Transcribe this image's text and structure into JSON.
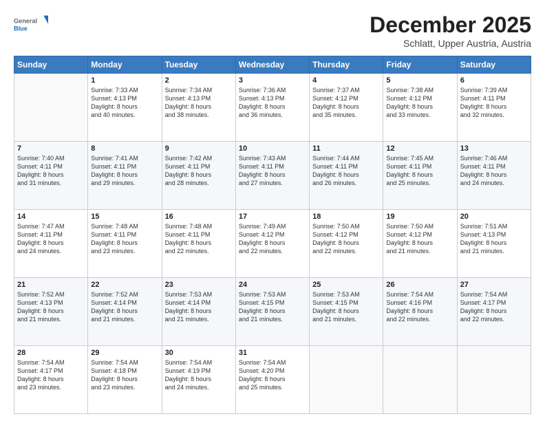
{
  "header": {
    "logo_general": "General",
    "logo_blue": "Blue",
    "month_title": "December 2025",
    "location": "Schlatt, Upper Austria, Austria"
  },
  "weekdays": [
    "Sunday",
    "Monday",
    "Tuesday",
    "Wednesday",
    "Thursday",
    "Friday",
    "Saturday"
  ],
  "weeks": [
    [
      {
        "day": "",
        "text": ""
      },
      {
        "day": "1",
        "text": "Sunrise: 7:33 AM\nSunset: 4:13 PM\nDaylight: 8 hours\nand 40 minutes."
      },
      {
        "day": "2",
        "text": "Sunrise: 7:34 AM\nSunset: 4:13 PM\nDaylight: 8 hours\nand 38 minutes."
      },
      {
        "day": "3",
        "text": "Sunrise: 7:36 AM\nSunset: 4:13 PM\nDaylight: 8 hours\nand 36 minutes."
      },
      {
        "day": "4",
        "text": "Sunrise: 7:37 AM\nSunset: 4:12 PM\nDaylight: 8 hours\nand 35 minutes."
      },
      {
        "day": "5",
        "text": "Sunrise: 7:38 AM\nSunset: 4:12 PM\nDaylight: 8 hours\nand 33 minutes."
      },
      {
        "day": "6",
        "text": "Sunrise: 7:39 AM\nSunset: 4:11 PM\nDaylight: 8 hours\nand 32 minutes."
      }
    ],
    [
      {
        "day": "7",
        "text": "Sunrise: 7:40 AM\nSunset: 4:11 PM\nDaylight: 8 hours\nand 31 minutes."
      },
      {
        "day": "8",
        "text": "Sunrise: 7:41 AM\nSunset: 4:11 PM\nDaylight: 8 hours\nand 29 minutes."
      },
      {
        "day": "9",
        "text": "Sunrise: 7:42 AM\nSunset: 4:11 PM\nDaylight: 8 hours\nand 28 minutes."
      },
      {
        "day": "10",
        "text": "Sunrise: 7:43 AM\nSunset: 4:11 PM\nDaylight: 8 hours\nand 27 minutes."
      },
      {
        "day": "11",
        "text": "Sunrise: 7:44 AM\nSunset: 4:11 PM\nDaylight: 8 hours\nand 26 minutes."
      },
      {
        "day": "12",
        "text": "Sunrise: 7:45 AM\nSunset: 4:11 PM\nDaylight: 8 hours\nand 25 minutes."
      },
      {
        "day": "13",
        "text": "Sunrise: 7:46 AM\nSunset: 4:11 PM\nDaylight: 8 hours\nand 24 minutes."
      }
    ],
    [
      {
        "day": "14",
        "text": "Sunrise: 7:47 AM\nSunset: 4:11 PM\nDaylight: 8 hours\nand 24 minutes."
      },
      {
        "day": "15",
        "text": "Sunrise: 7:48 AM\nSunset: 4:11 PM\nDaylight: 8 hours\nand 23 minutes."
      },
      {
        "day": "16",
        "text": "Sunrise: 7:48 AM\nSunset: 4:11 PM\nDaylight: 8 hours\nand 22 minutes."
      },
      {
        "day": "17",
        "text": "Sunrise: 7:49 AM\nSunset: 4:12 PM\nDaylight: 8 hours\nand 22 minutes."
      },
      {
        "day": "18",
        "text": "Sunrise: 7:50 AM\nSunset: 4:12 PM\nDaylight: 8 hours\nand 22 minutes."
      },
      {
        "day": "19",
        "text": "Sunrise: 7:50 AM\nSunset: 4:12 PM\nDaylight: 8 hours\nand 21 minutes."
      },
      {
        "day": "20",
        "text": "Sunrise: 7:51 AM\nSunset: 4:13 PM\nDaylight: 8 hours\nand 21 minutes."
      }
    ],
    [
      {
        "day": "21",
        "text": "Sunrise: 7:52 AM\nSunset: 4:13 PM\nDaylight: 8 hours\nand 21 minutes."
      },
      {
        "day": "22",
        "text": "Sunrise: 7:52 AM\nSunset: 4:14 PM\nDaylight: 8 hours\nand 21 minutes."
      },
      {
        "day": "23",
        "text": "Sunrise: 7:53 AM\nSunset: 4:14 PM\nDaylight: 8 hours\nand 21 minutes."
      },
      {
        "day": "24",
        "text": "Sunrise: 7:53 AM\nSunset: 4:15 PM\nDaylight: 8 hours\nand 21 minutes."
      },
      {
        "day": "25",
        "text": "Sunrise: 7:53 AM\nSunset: 4:15 PM\nDaylight: 8 hours\nand 21 minutes."
      },
      {
        "day": "26",
        "text": "Sunrise: 7:54 AM\nSunset: 4:16 PM\nDaylight: 8 hours\nand 22 minutes."
      },
      {
        "day": "27",
        "text": "Sunrise: 7:54 AM\nSunset: 4:17 PM\nDaylight: 8 hours\nand 22 minutes."
      }
    ],
    [
      {
        "day": "28",
        "text": "Sunrise: 7:54 AM\nSunset: 4:17 PM\nDaylight: 8 hours\nand 23 minutes."
      },
      {
        "day": "29",
        "text": "Sunrise: 7:54 AM\nSunset: 4:18 PM\nDaylight: 8 hours\nand 23 minutes."
      },
      {
        "day": "30",
        "text": "Sunrise: 7:54 AM\nSunset: 4:19 PM\nDaylight: 8 hours\nand 24 minutes."
      },
      {
        "day": "31",
        "text": "Sunrise: 7:54 AM\nSunset: 4:20 PM\nDaylight: 8 hours\nand 25 minutes."
      },
      {
        "day": "",
        "text": ""
      },
      {
        "day": "",
        "text": ""
      },
      {
        "day": "",
        "text": ""
      }
    ]
  ]
}
